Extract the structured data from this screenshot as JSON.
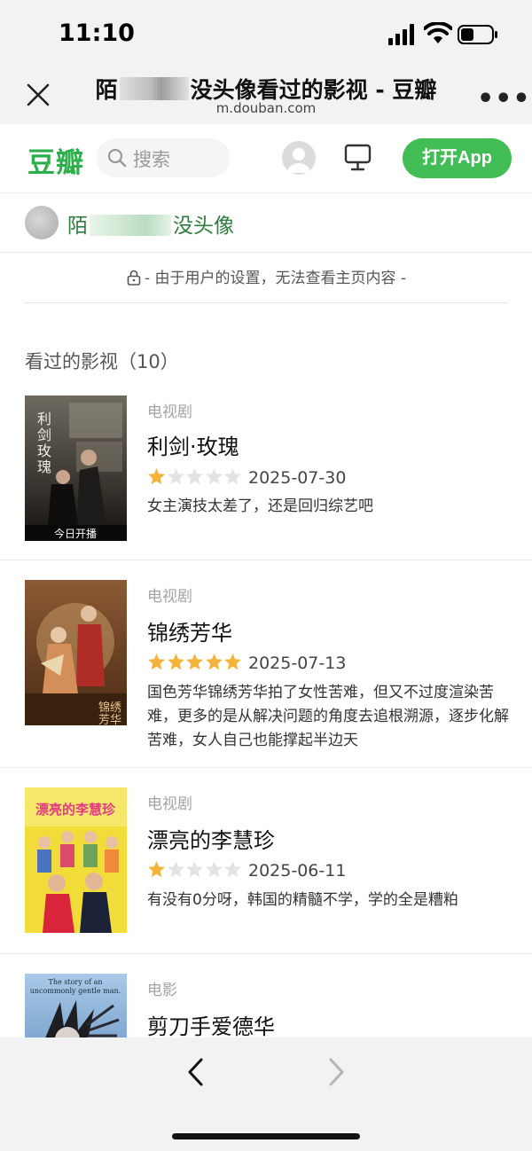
{
  "status": {
    "time": "11:10"
  },
  "titlebar": {
    "title_prefix": "陌",
    "title_suffix": "没头像看过的影视 - 豆瓣",
    "url": "m.douban.com"
  },
  "header": {
    "logo": "豆瓣",
    "search_placeholder": "搜索",
    "open_app_label": "打开App",
    "brand_color": "#42bd56"
  },
  "user": {
    "name_prefix": "陌",
    "name_suffix": "没头像"
  },
  "notice": {
    "text": "- 由于用户的设置，无法查看主页内容 -"
  },
  "section": {
    "title": "看过的影视（10）"
  },
  "items": [
    {
      "type": "电视剧",
      "title": "利剑·玫瑰",
      "rating": 1,
      "date": "2025-07-30",
      "comment": "女主演技太差了，还是回归综艺吧",
      "poster_caption": "今日开播",
      "poster_title": "利剑玫瑰"
    },
    {
      "type": "电视剧",
      "title": "锦绣芳华",
      "rating": 5,
      "date": "2025-07-13",
      "comment": "国色芳华锦绣芳华拍了女性苦难，但又不过度渲染苦难，更多的是从解决问题的角度去追根溯源，逐步化解苦难，女人自己也能撑起半边天",
      "poster_title": "锦绣芳华"
    },
    {
      "type": "电视剧",
      "title": "漂亮的李慧珍",
      "rating": 1,
      "date": "2025-06-11",
      "comment": "有没有0分呀，韩国的精髓不学，学的全是糟粕",
      "poster_title": "漂亮的李慧珍"
    },
    {
      "type": "电影",
      "title": "剪刀手爱德华",
      "poster_title": "The story of an uncommonly gentle man."
    }
  ]
}
